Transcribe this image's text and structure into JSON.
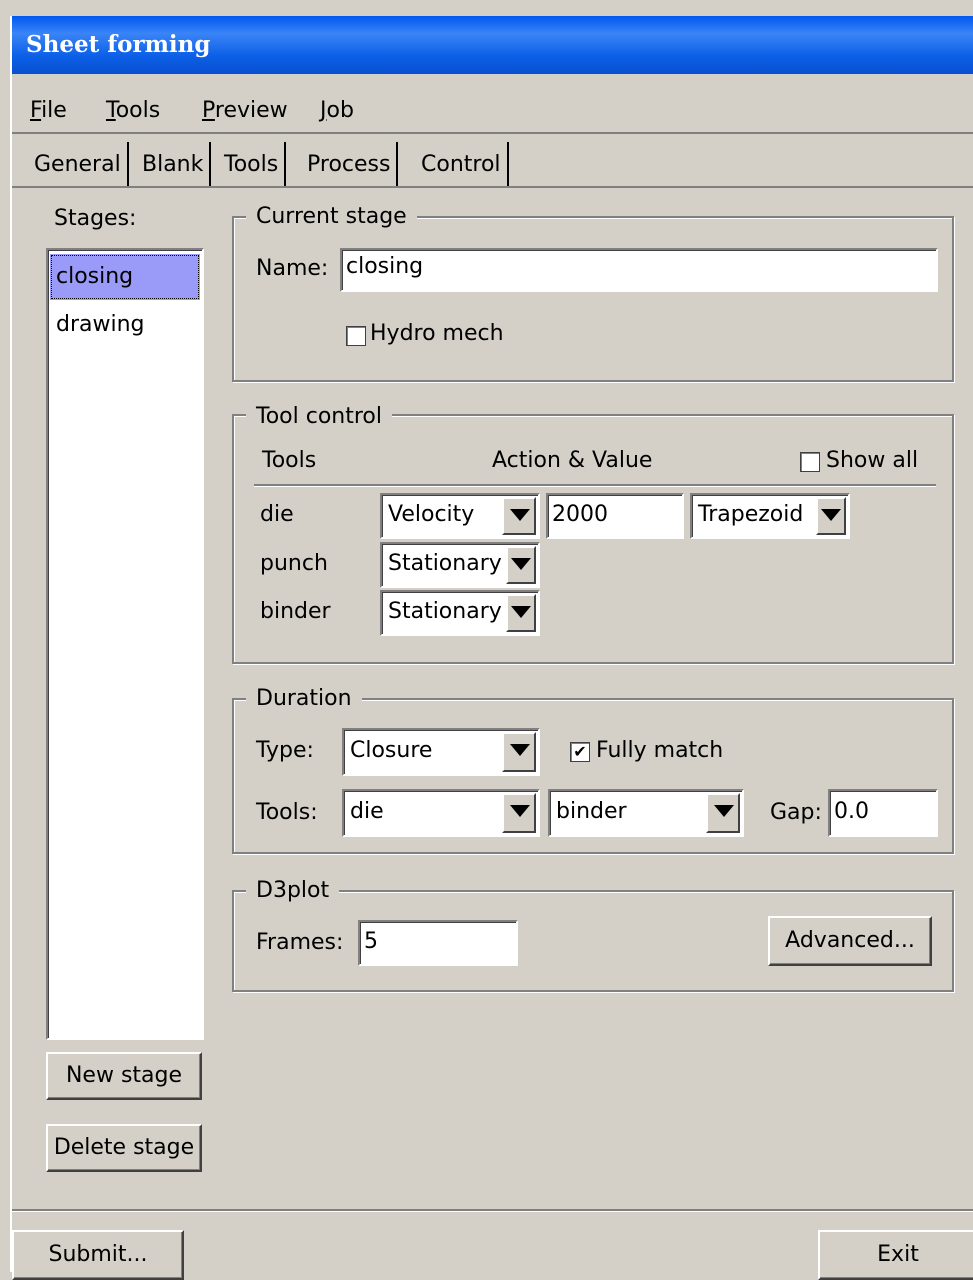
{
  "window": {
    "title": "Sheet forming"
  },
  "menu": [
    {
      "u": "F",
      "rest": "ile"
    },
    {
      "u": "T",
      "rest": "ools"
    },
    {
      "u": "P",
      "rest": "review"
    },
    {
      "u": "J",
      "rest": "ob"
    }
  ],
  "tabs": [
    "General",
    "Blank",
    "Tools",
    "Process",
    "Control"
  ],
  "active_tab": "Process",
  "stages": {
    "label": "Stages:",
    "items": [
      "closing",
      "drawing"
    ],
    "selected": "closing",
    "new_button": "New stage",
    "delete_button": "Delete stage"
  },
  "current_stage": {
    "title": "Current stage",
    "name_label": "Name:",
    "name_value": "closing",
    "hydro_label": "Hydro mech",
    "hydro_checked": false
  },
  "tool_control": {
    "title": "Tool control",
    "col_tools": "Tools",
    "col_action": "Action & Value",
    "show_all_label": "Show all",
    "show_all_checked": false,
    "rows": [
      {
        "tool": "die",
        "action": "Velocity",
        "value": "2000",
        "profile": "Trapezoid"
      },
      {
        "tool": "punch",
        "action": "Stationary"
      },
      {
        "tool": "binder",
        "action": "Stationary"
      }
    ]
  },
  "duration": {
    "title": "Duration",
    "type_label": "Type:",
    "type_value": "Closure",
    "fully_match_label": "Fully match",
    "fully_match_checked": true,
    "tools_label": "Tools:",
    "tool1": "die",
    "tool2": "binder",
    "gap_label": "Gap:",
    "gap_value": "0.0"
  },
  "d3plot": {
    "title": "D3plot",
    "frames_label": "Frames:",
    "frames_value": "5",
    "advanced_button": "Advanced..."
  },
  "footer": {
    "submit": "Submit...",
    "exit": "Exit"
  },
  "icons": {
    "check": "✔",
    "dropdown": "chevron-down-icon"
  }
}
